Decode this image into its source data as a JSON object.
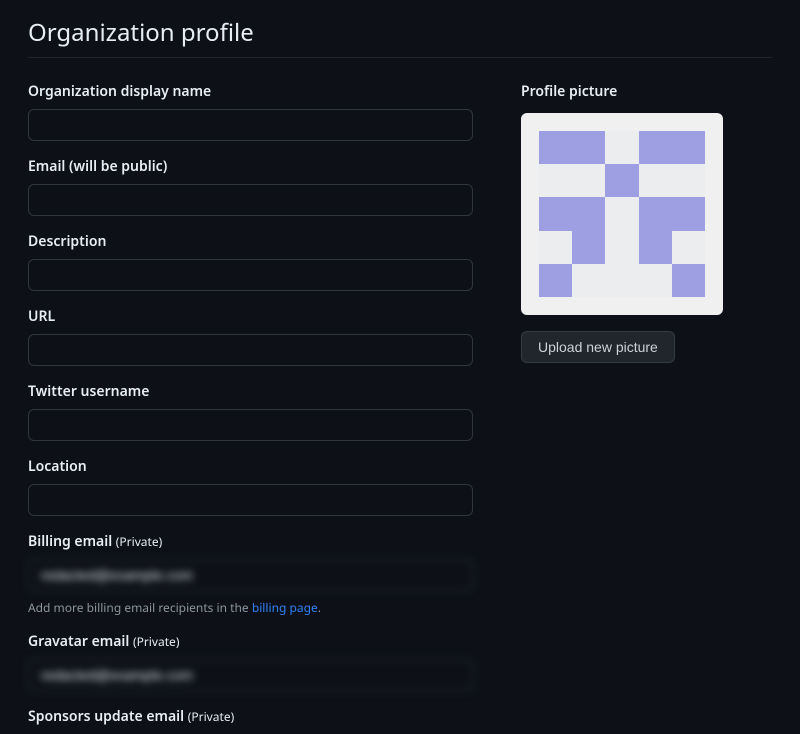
{
  "page": {
    "title": "Organization profile"
  },
  "form": {
    "display_name": {
      "label": "Organization display name",
      "value": ""
    },
    "email": {
      "label": "Email (will be public)",
      "value": ""
    },
    "description": {
      "label": "Description",
      "value": ""
    },
    "url": {
      "label": "URL",
      "value": ""
    },
    "twitter": {
      "label": "Twitter username",
      "value": ""
    },
    "location": {
      "label": "Location",
      "value": ""
    },
    "billing_email": {
      "label": "Billing email ",
      "private_tag": "(Private)",
      "value": "redacted@example.com",
      "note_prefix": "Add more billing email recipients in the ",
      "note_link": "billing page",
      "note_suffix": "."
    },
    "gravatar_email": {
      "label": "Gravatar email ",
      "private_tag": "(Private)",
      "value": "redacted@example.com"
    },
    "sponsors_email": {
      "label": "Sponsors update email ",
      "private_tag": "(Private)"
    }
  },
  "aside": {
    "picture_label": "Profile picture",
    "upload_label": "Upload new picture"
  }
}
